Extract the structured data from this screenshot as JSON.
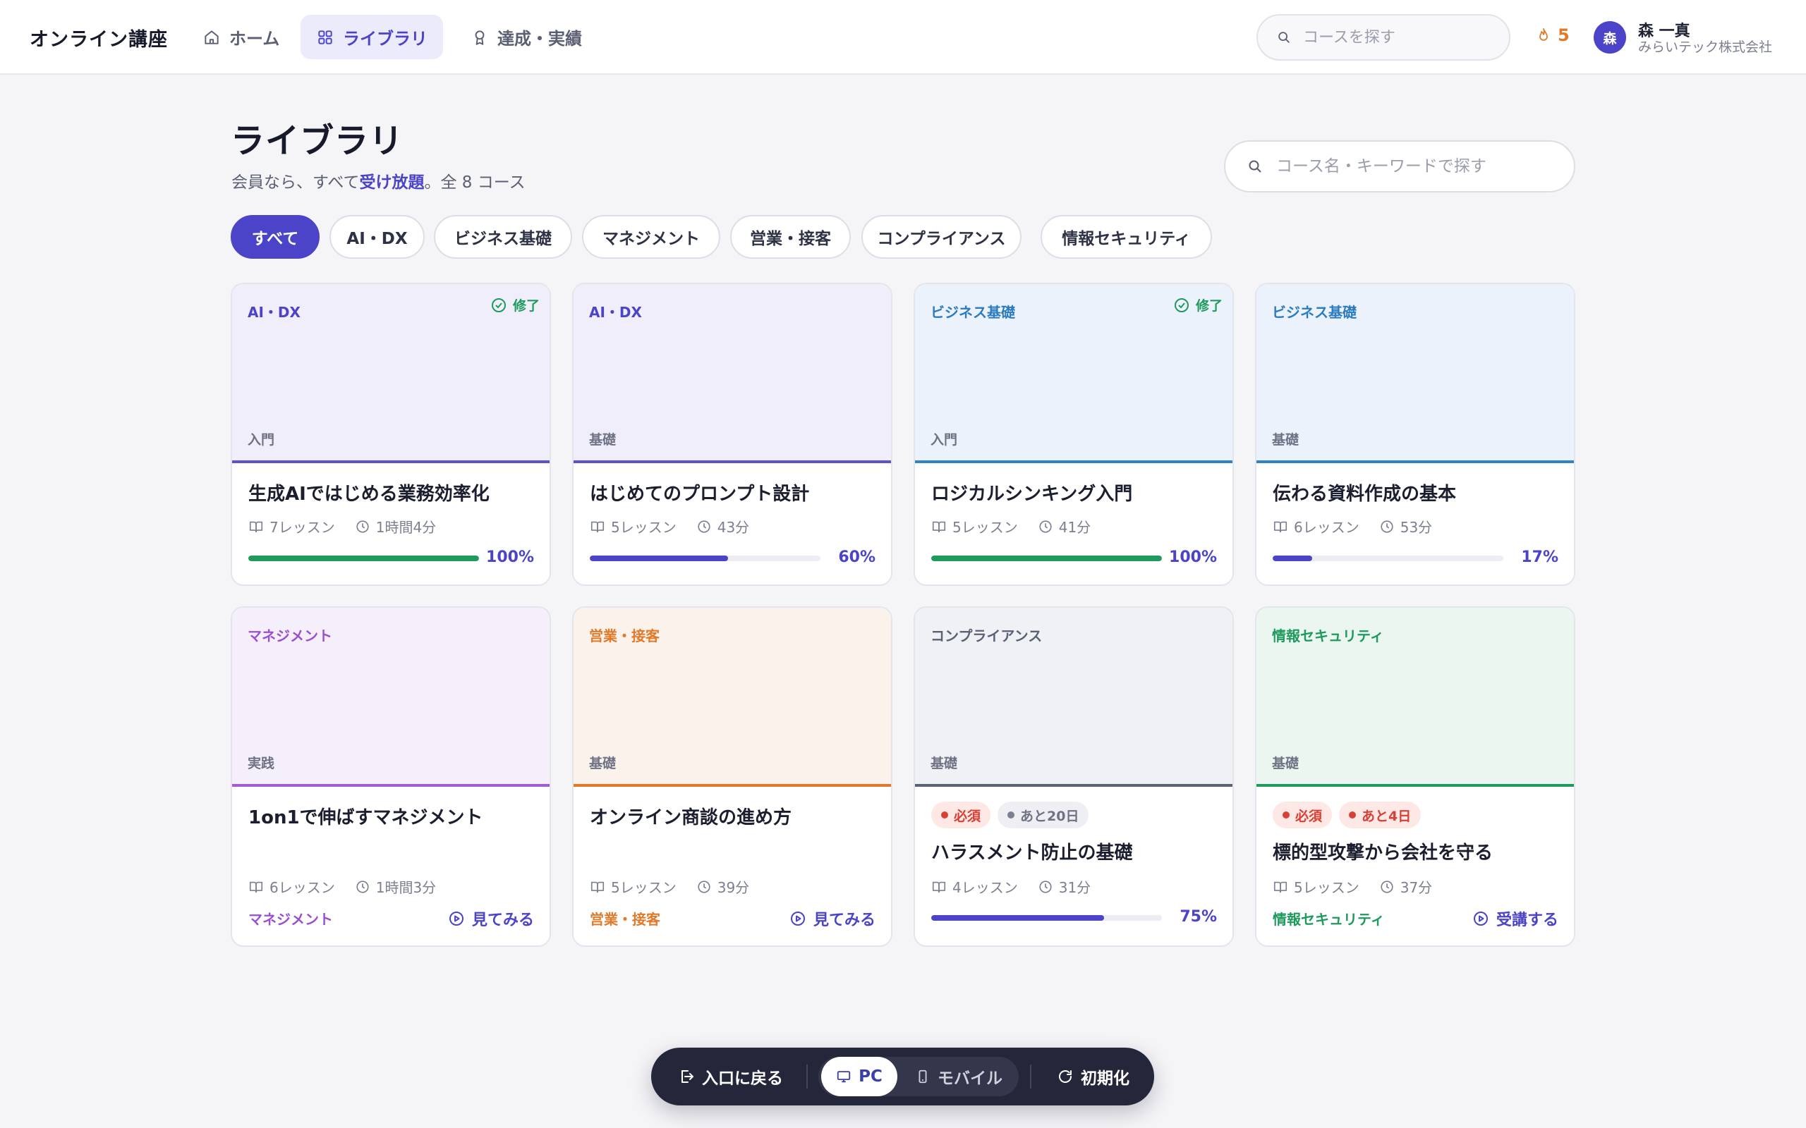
{
  "app": {
    "brand": "オンライン講座"
  },
  "nav": {
    "items": [
      {
        "label": "ホーム",
        "icon": "home-icon"
      },
      {
        "label": "ライブラリ",
        "icon": "grid-icon",
        "active": true
      },
      {
        "label": "達成・実績",
        "icon": "award-icon"
      }
    ],
    "search_placeholder": "コースを探す",
    "streak": "5",
    "user": {
      "initial": "森",
      "name": "森 一真",
      "company": "みらいテック株式会社"
    }
  },
  "page": {
    "title": "ライブラリ",
    "subtitle_pre": "会員なら、すべて",
    "subtitle_highlight": "受け放題",
    "subtitle_post": "。全 8 コース",
    "search_placeholder": "コース名・キーワードで探す"
  },
  "filters": [
    "すべて",
    "AI・DX",
    "ビジネス基礎",
    "マネジメント",
    "営業・接客",
    "コンプライアンス",
    "情報セキュリティ"
  ],
  "colors": {
    "accent": "#4b44c8",
    "ai_dx": "#4b44c8",
    "business": "#2b7bc0",
    "management": "#9b4fd0",
    "sales": "#e07a2a",
    "compliance": "#5a6275",
    "security": "#1e9a5c",
    "complete_green": "#1e9a5c"
  },
  "courses": [
    {
      "category": "AI・DX",
      "level": "入門",
      "completed_label": "修了",
      "title": "生成AIではじめる業務効率化",
      "lessons": "7レッスン",
      "duration": "1時間4分",
      "progress_pct": 100,
      "progress_label": "100%"
    },
    {
      "category": "AI・DX",
      "level": "基礎",
      "title": "はじめてのプロンプト設計",
      "lessons": "5レッスン",
      "duration": "43分",
      "progress_pct": 60,
      "progress_label": "60%"
    },
    {
      "category": "ビジネス基礎",
      "level": "入門",
      "completed_label": "修了",
      "title": "ロジカルシンキング入門",
      "lessons": "5レッスン",
      "duration": "41分",
      "progress_pct": 100,
      "progress_label": "100%"
    },
    {
      "category": "ビジネス基礎",
      "level": "基礎",
      "title": "伝わる資料作成の基本",
      "lessons": "6レッスン",
      "duration": "53分",
      "progress_pct": 17,
      "progress_label": "17%"
    },
    {
      "category": "マネジメント",
      "level": "実践",
      "title": "1on1で伸ばすマネジメント",
      "lessons": "6レッスン",
      "duration": "1時間3分",
      "footer_category": "マネジメント",
      "action": "見てみる"
    },
    {
      "category": "営業・接客",
      "level": "基礎",
      "title": "オンライン商談の進め方",
      "lessons": "5レッスン",
      "duration": "39分",
      "footer_category": "営業・接客",
      "action": "見てみる"
    },
    {
      "category": "コンプライアンス",
      "level": "基礎",
      "badges": [
        "必須",
        "あと20日"
      ],
      "title": "ハラスメント防止の基礎",
      "lessons": "4レッスン",
      "duration": "31分",
      "progress_pct": 75,
      "progress_label": "75%"
    },
    {
      "category": "情報セキュリティ",
      "level": "基礎",
      "badges": [
        "必須",
        "あと4日"
      ],
      "title": "標的型攻撃から会社を守る",
      "lessons": "5レッスン",
      "duration": "37分",
      "footer_category": "情報セキュリティ",
      "action": "受講する"
    }
  ],
  "dock": {
    "back_label": "入口に戻る",
    "pc_label": "PC",
    "mobile_label": "モバイル",
    "reset_label": "初期化",
    "mode": "PC"
  }
}
